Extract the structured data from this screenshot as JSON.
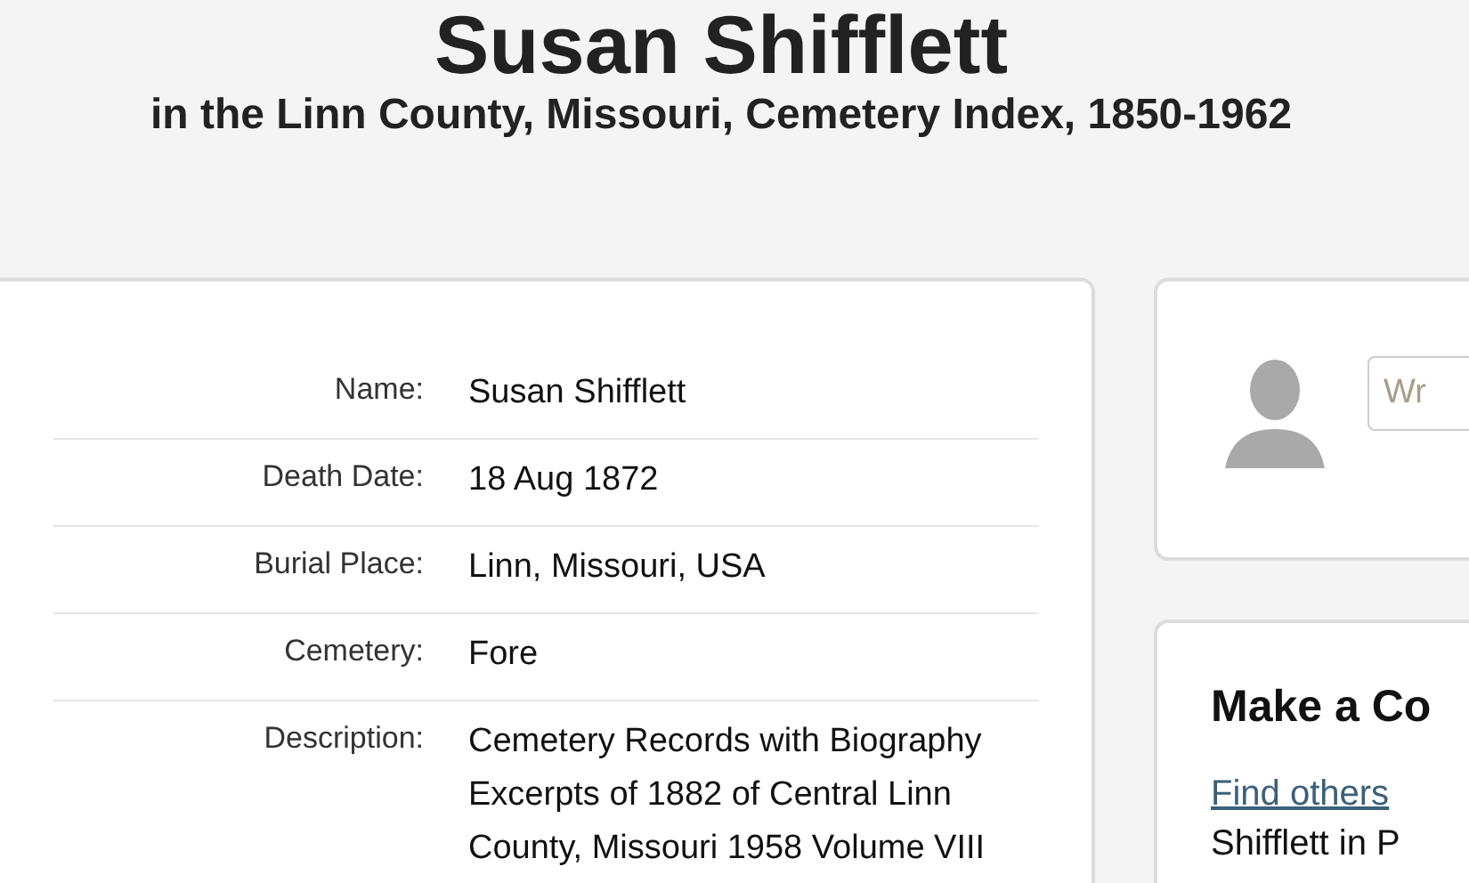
{
  "header": {
    "title": "Susan Shifflett",
    "subtitle": "in the Linn County, Missouri, Cemetery Index, 1850-1962"
  },
  "record": {
    "fields": [
      {
        "label": "Name:",
        "value": "Susan Shifflett"
      },
      {
        "label": "Death Date:",
        "value": "18 Aug 1872"
      },
      {
        "label": "Burial Place:",
        "value": "Linn, Missouri, USA"
      },
      {
        "label": "Cemetery:",
        "value": "Fore"
      },
      {
        "label": "Description:",
        "value": "Cemetery Records with Biography Excerpts of 1882 of Central Linn County, Missouri 1958 Volume VIII"
      }
    ]
  },
  "comment_card": {
    "placeholder": "Wr"
  },
  "connection_card": {
    "heading": "Make a Co",
    "link": "Find others",
    "text": "Shifflett in P"
  }
}
